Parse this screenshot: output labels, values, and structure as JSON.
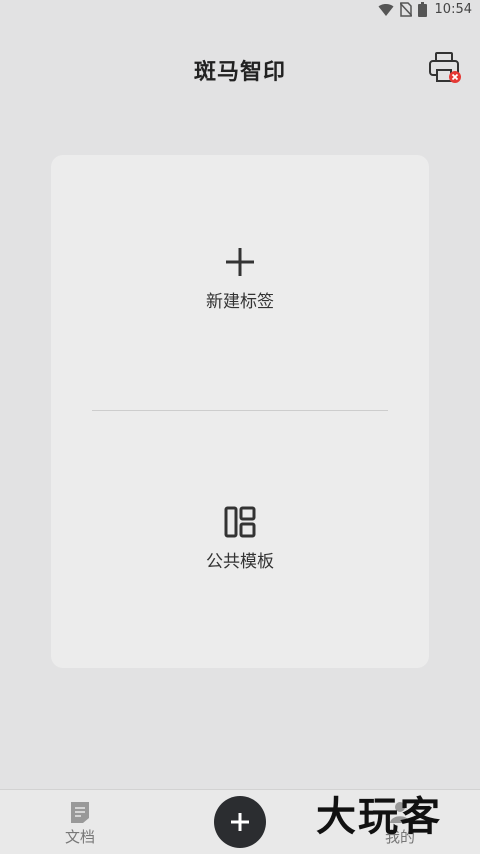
{
  "status_bar": {
    "time": "10:54",
    "icons": [
      "wifi-icon",
      "no-sim-icon",
      "battery-icon"
    ]
  },
  "header": {
    "title": "斑马智印",
    "printer_icon": "printer-disconnected-icon",
    "error_color": "#e53935"
  },
  "card": {
    "new_label": "新建标签",
    "new_icon": "plus-icon",
    "templates_label": "公共模板",
    "templates_icon": "templates-icon"
  },
  "bottom_nav": {
    "docs_label": "文档",
    "docs_icon": "document-icon",
    "add_icon": "plus-icon",
    "mine_label": "我的",
    "mine_icon": "user-icon"
  },
  "watermark": "大玩客",
  "colors": {
    "background": "#e2e2e3",
    "card": "#ececec",
    "fab": "#2b2d30"
  }
}
